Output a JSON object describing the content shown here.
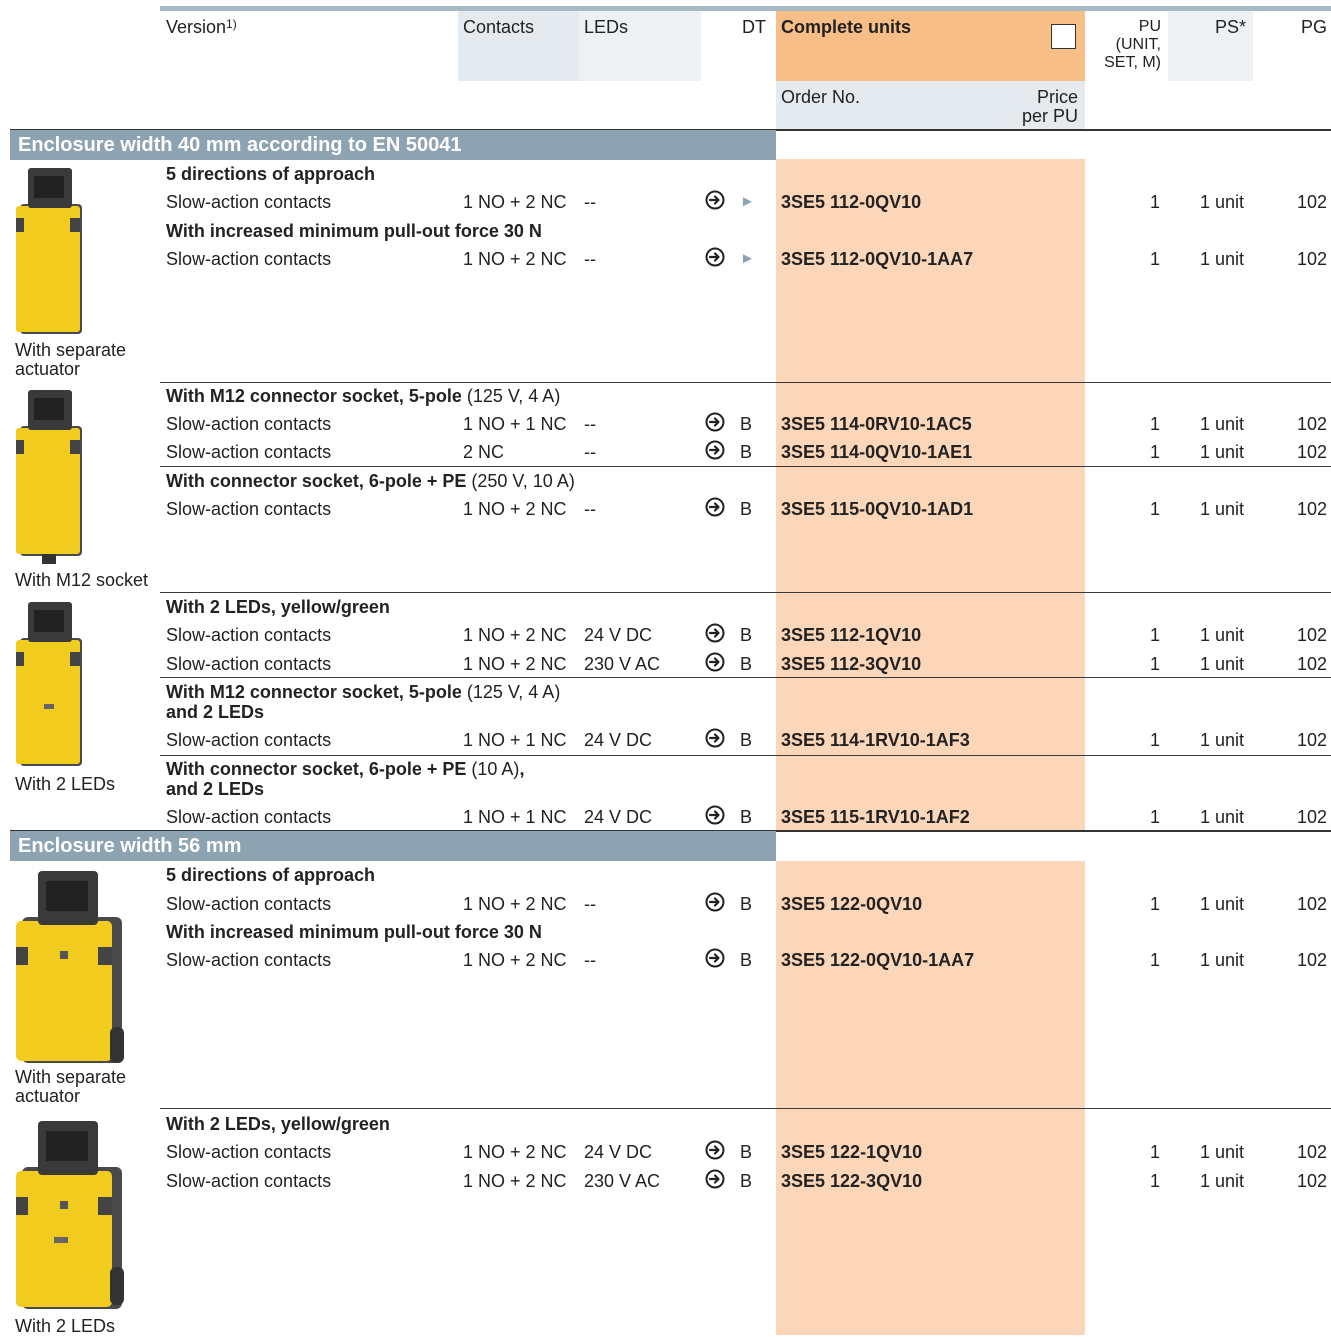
{
  "header": {
    "version": "Version",
    "version_sup": "1)",
    "contacts": "Contacts",
    "leds": "LEDs",
    "dt": "DT",
    "complete_units": "Complete units",
    "order_no": "Order No.",
    "price_line1": "Price",
    "price_line2": "per PU",
    "pu_line1": "PU",
    "pu_line2": "(UNIT,",
    "pu_line3": "SET, M)",
    "ps": "PS*",
    "pg": "PG"
  },
  "sections": {
    "s1": "Enclosure width 40 mm according to EN 50041",
    "s2": "Enclosure width 56 mm"
  },
  "images": {
    "img1_line1": "With separate",
    "img1_line2": "actuator",
    "img2": "With M12 socket",
    "img3": "With 2 LEDs",
    "img4_line1": "With separate",
    "img4_line2": "actuator",
    "img5": "With 2 LEDs"
  },
  "groups": {
    "g1": "5 directions of approach",
    "g2": "With increased minimum pull-out force 30 N",
    "g3_bold": "With M12 connector socket, 5-pole",
    "g3_normal": " (125 V, 4 A)",
    "g4_bold": "With connector socket, 6-pole + PE",
    "g4_normal": " (250 V, 10 A)",
    "g5": "With 2 LEDs, yellow/green",
    "g6_bold": "With M12 connector socket, 5-pole",
    "g6_normal": " (125 V, 4 A)",
    "g6_line2": "and 2 LEDs",
    "g7_bold": "With connector socket, 6-pole + PE",
    "g7_normal": " (10 A)",
    "g7_comma": ",",
    "g7_line2": "and 2 LEDs",
    "g8": "5 directions of approach",
    "g9": "With increased minimum pull-out force 30 N",
    "g10": "With 2 LEDs, yellow/green"
  },
  "rows": [
    {
      "version": "Slow-action contacts",
      "contacts": "1 NO + 2 NC",
      "leds": "--",
      "dt": "►",
      "order": "3SE5 112-0QV10",
      "pu": "1",
      "ps": "1 unit",
      "pg": "102"
    },
    {
      "version": "Slow-action contacts",
      "contacts": "1 NO + 2 NC",
      "leds": "--",
      "dt": "►",
      "order": "3SE5 112-0QV10-1AA7",
      "pu": "1",
      "ps": "1 unit",
      "pg": "102"
    },
    {
      "version": "Slow-action contacts",
      "contacts": "1 NO + 1 NC",
      "leds": "--",
      "dt": "B",
      "order": "3SE5 114-0RV10-1AC5",
      "pu": "1",
      "ps": "1 unit",
      "pg": "102"
    },
    {
      "version": "Slow-action contacts",
      "contacts": "2 NC",
      "leds": "--",
      "dt": "B",
      "order": "3SE5 114-0QV10-1AE1",
      "pu": "1",
      "ps": "1 unit",
      "pg": "102"
    },
    {
      "version": "Slow-action contacts",
      "contacts": "1 NO + 2 NC",
      "leds": "--",
      "dt": "B",
      "order": "3SE5 115-0QV10-1AD1",
      "pu": "1",
      "ps": "1 unit",
      "pg": "102"
    },
    {
      "version": "Slow-action contacts",
      "contacts": "1 NO + 2 NC",
      "leds": "24 V DC",
      "dt": "B",
      "order": "3SE5 112-1QV10",
      "pu": "1",
      "ps": "1 unit",
      "pg": "102"
    },
    {
      "version": "Slow-action contacts",
      "contacts": "1 NO + 2 NC",
      "leds": "230 V AC",
      "dt": "B",
      "order": "3SE5 112-3QV10",
      "pu": "1",
      "ps": "1 unit",
      "pg": "102"
    },
    {
      "version": "Slow-action contacts",
      "contacts": "1 NO + 1 NC",
      "leds": "24 V DC",
      "dt": "B",
      "order": "3SE5 114-1RV10-1AF3",
      "pu": "1",
      "ps": "1 unit",
      "pg": "102"
    },
    {
      "version": "Slow-action contacts",
      "contacts": "1 NO + 1 NC",
      "leds": "24 V DC",
      "dt": "B",
      "order": "3SE5 115-1RV10-1AF2",
      "pu": "1",
      "ps": "1 unit",
      "pg": "102"
    },
    {
      "version": "Slow-action contacts",
      "contacts": "1 NO + 2 NC",
      "leds": "--",
      "dt": "B",
      "order": "3SE5 122-0QV10",
      "pu": "1",
      "ps": "1 unit",
      "pg": "102"
    },
    {
      "version": "Slow-action contacts",
      "contacts": "1 NO + 2 NC",
      "leds": "--",
      "dt": "B",
      "order": "3SE5 122-0QV10-1AA7",
      "pu": "1",
      "ps": "1 unit",
      "pg": "102"
    },
    {
      "version": "Slow-action contacts",
      "contacts": "1 NO + 2 NC",
      "leds": "24 V DC",
      "dt": "B",
      "order": "3SE5 122-1QV10",
      "pu": "1",
      "ps": "1 unit",
      "pg": "102"
    },
    {
      "version": "Slow-action contacts",
      "contacts": "1 NO + 2 NC",
      "leds": "230 V AC",
      "dt": "B",
      "order": "3SE5 122-3QV10",
      "pu": "1",
      "ps": "1 unit",
      "pg": "102"
    }
  ],
  "colors": {
    "section_bar": "#8ea3b1",
    "header_gray": "#e5eaee",
    "complete_units_orange": "#f8be88",
    "order_column": "#fbd6b8",
    "switch_yellow": "#f2cb1f",
    "switch_head": "#3a3a3a"
  },
  "icons": {
    "delivery": "circled-arrow-icon"
  }
}
